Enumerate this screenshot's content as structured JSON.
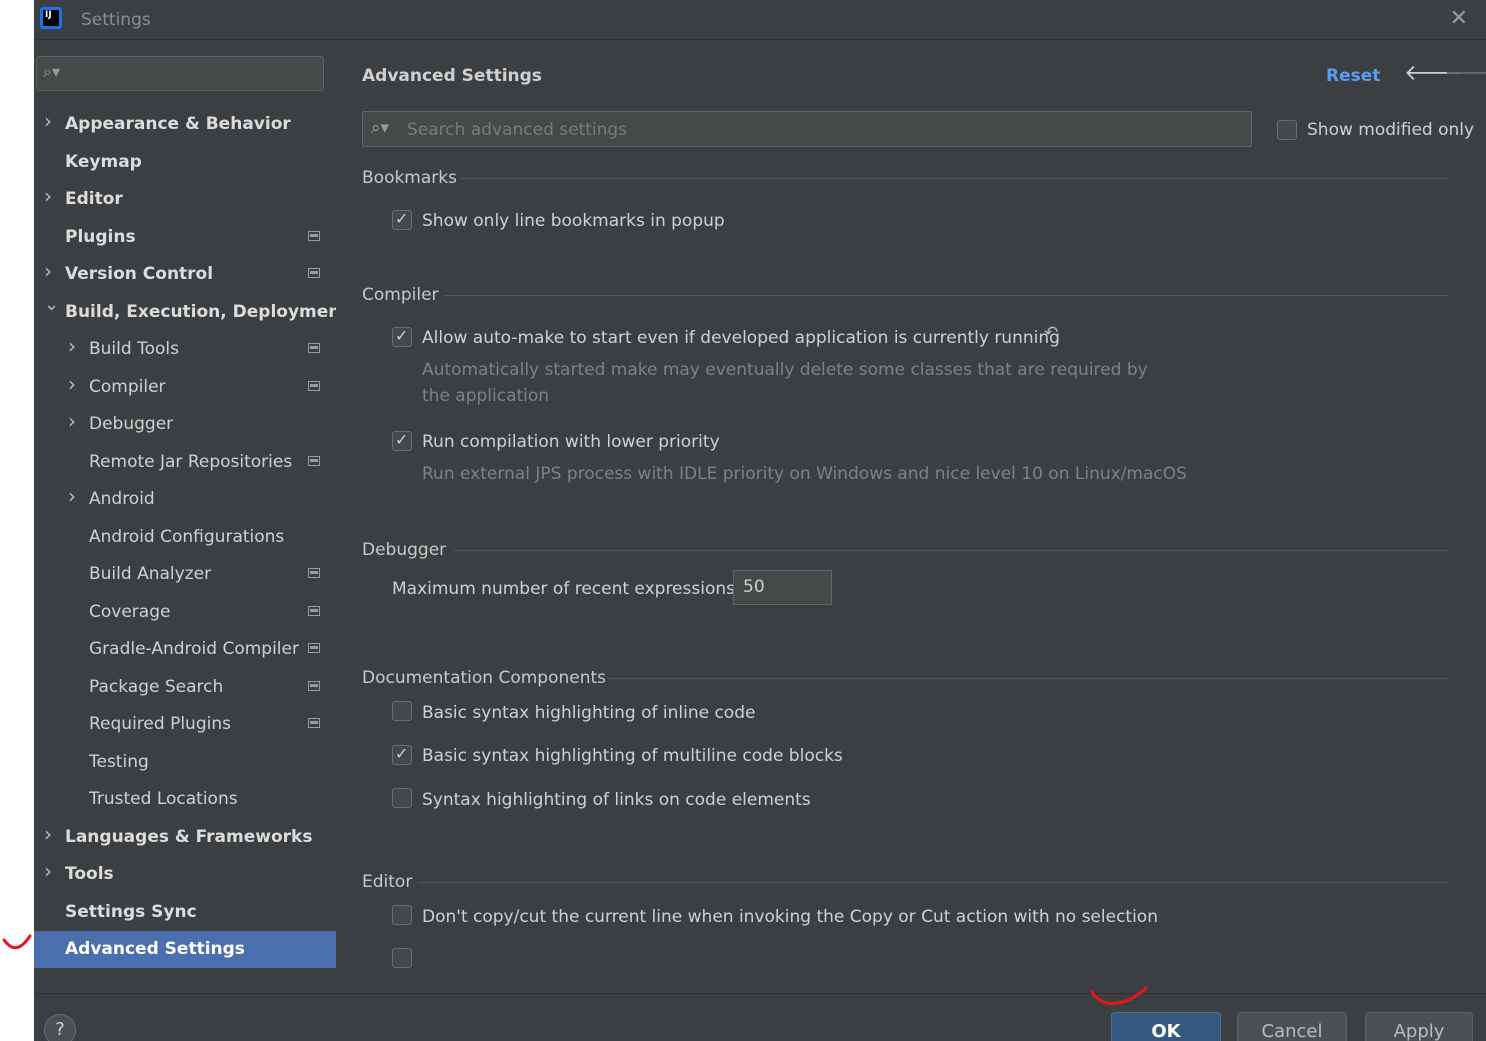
{
  "window": {
    "title": "Settings"
  },
  "sidebar": {
    "items": [
      {
        "label": "Appearance & Behavior",
        "bold": true,
        "arrow": "right"
      },
      {
        "label": "Keymap",
        "bold": true
      },
      {
        "label": "Editor",
        "bold": true,
        "arrow": "right"
      },
      {
        "label": "Plugins",
        "bold": true,
        "project_icon": true
      },
      {
        "label": "Version Control",
        "bold": true,
        "arrow": "right",
        "project_icon": true
      },
      {
        "label": "Build, Execution, Deployment",
        "bold": true,
        "arrow": "down"
      },
      {
        "label": "Build Tools",
        "arrow": "right",
        "project_icon": true
      },
      {
        "label": "Compiler",
        "arrow": "right",
        "project_icon": true
      },
      {
        "label": "Debugger",
        "arrow": "right"
      },
      {
        "label": "Remote Jar Repositories",
        "project_icon": true
      },
      {
        "label": "Android",
        "arrow": "right"
      },
      {
        "label": "Android Configurations"
      },
      {
        "label": "Build Analyzer",
        "project_icon": true
      },
      {
        "label": "Coverage",
        "project_icon": true
      },
      {
        "label": "Gradle-Android Compiler",
        "project_icon": true
      },
      {
        "label": "Package Search",
        "project_icon": true
      },
      {
        "label": "Required Plugins",
        "project_icon": true
      },
      {
        "label": "Testing"
      },
      {
        "label": "Trusted Locations"
      },
      {
        "label": "Languages & Frameworks",
        "bold": true,
        "arrow": "right"
      },
      {
        "label": "Tools",
        "bold": true,
        "arrow": "right"
      },
      {
        "label": "Settings Sync",
        "bold": true
      },
      {
        "label": "Advanced Settings",
        "bold": true,
        "selected": true
      }
    ]
  },
  "main": {
    "title": "Advanced Settings",
    "reset_label": "Reset",
    "search_placeholder": "Search advanced settings",
    "show_modified_label": "Show modified only",
    "show_modified_checked": false,
    "sections": {
      "bookmarks": {
        "header": "Bookmarks",
        "opt1": {
          "label": "Show only line bookmarks in popup",
          "checked": true
        }
      },
      "compiler": {
        "header": "Compiler",
        "opt1": {
          "label": "Allow auto-make to start even if developed application is currently running",
          "checked": true,
          "desc": "Automatically started make may eventually delete some classes that are required by the application"
        },
        "opt2": {
          "label": "Run compilation with lower priority",
          "checked": true,
          "desc": "Run external JPS process with IDLE priority on Windows and nice level 10 on Linux/macOS"
        }
      },
      "debugger": {
        "header": "Debugger",
        "max_label": "Maximum number of recent expressions:",
        "max_value": "50"
      },
      "documentation": {
        "header": "Documentation Components",
        "opt1": {
          "label": "Basic syntax highlighting of inline code",
          "checked": false
        },
        "opt2": {
          "label": "Basic syntax highlighting of multiline code blocks",
          "checked": true
        },
        "opt3": {
          "label": "Syntax highlighting of links on code elements",
          "checked": false
        }
      },
      "editor": {
        "header": "Editor",
        "opt1": {
          "label": "Don't copy/cut the current line when invoking the Copy or Cut action with no selection",
          "checked": false
        }
      }
    }
  },
  "footer": {
    "help_label": "?",
    "ok_label": "OK",
    "cancel_label": "Cancel",
    "apply_label": "Apply"
  },
  "colors": {
    "background": "#3c3f41",
    "selection": "#4b6eaf",
    "link": "#589df6",
    "ok_button": "#365880",
    "annotation": "#e8141e"
  },
  "icons": {
    "app": "intellij-icon",
    "close": "close-icon",
    "search": "search-icon",
    "back": "arrow-left-icon",
    "forward": "arrow-right-icon",
    "undo": "undo-icon",
    "project": "project-level-icon",
    "help": "help-icon"
  }
}
